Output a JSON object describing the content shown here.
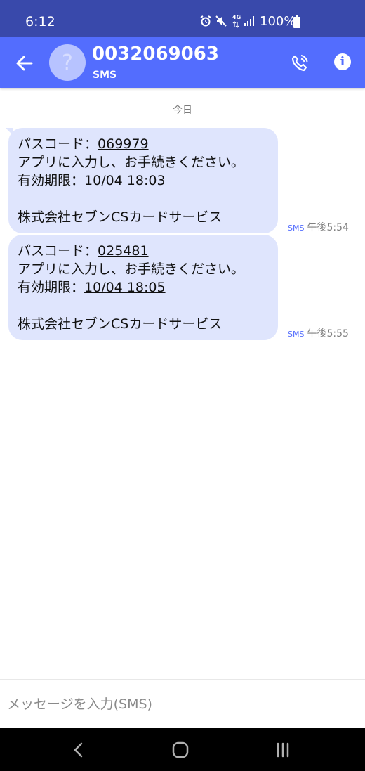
{
  "status_bar": {
    "time": "6:12",
    "battery": "100%",
    "network": "4G"
  },
  "header": {
    "contact_number": "0032069063",
    "contact_type": "SMS",
    "avatar_glyph": "?",
    "info_glyph": "i"
  },
  "conversation": {
    "date_label": "今日",
    "messages": [
      {
        "passcode_label": "パスコード：",
        "passcode": "069979",
        "instruction": "アプリに入力し、お手続きください。",
        "expiry_label": "有効期限：",
        "expiry": "10/04 18:03",
        "sender": "株式会社セブンCSカードサービス",
        "tag": "SMS",
        "time": "午後5:54"
      },
      {
        "passcode_label": "パスコード：",
        "passcode": "025481",
        "instruction": "アプリに入力し、お手続きください。",
        "expiry_label": "有効期限：",
        "expiry": "10/04 18:05",
        "sender": "株式会社セブンCSカードサービス",
        "tag": "SMS",
        "time": "午後5:55"
      }
    ]
  },
  "composer": {
    "placeholder": "メッセージを入力(SMS)"
  },
  "colors": {
    "status_bar": "#3949ab",
    "app_bar": "#536dfe",
    "bubble": "#dfe5fd"
  }
}
